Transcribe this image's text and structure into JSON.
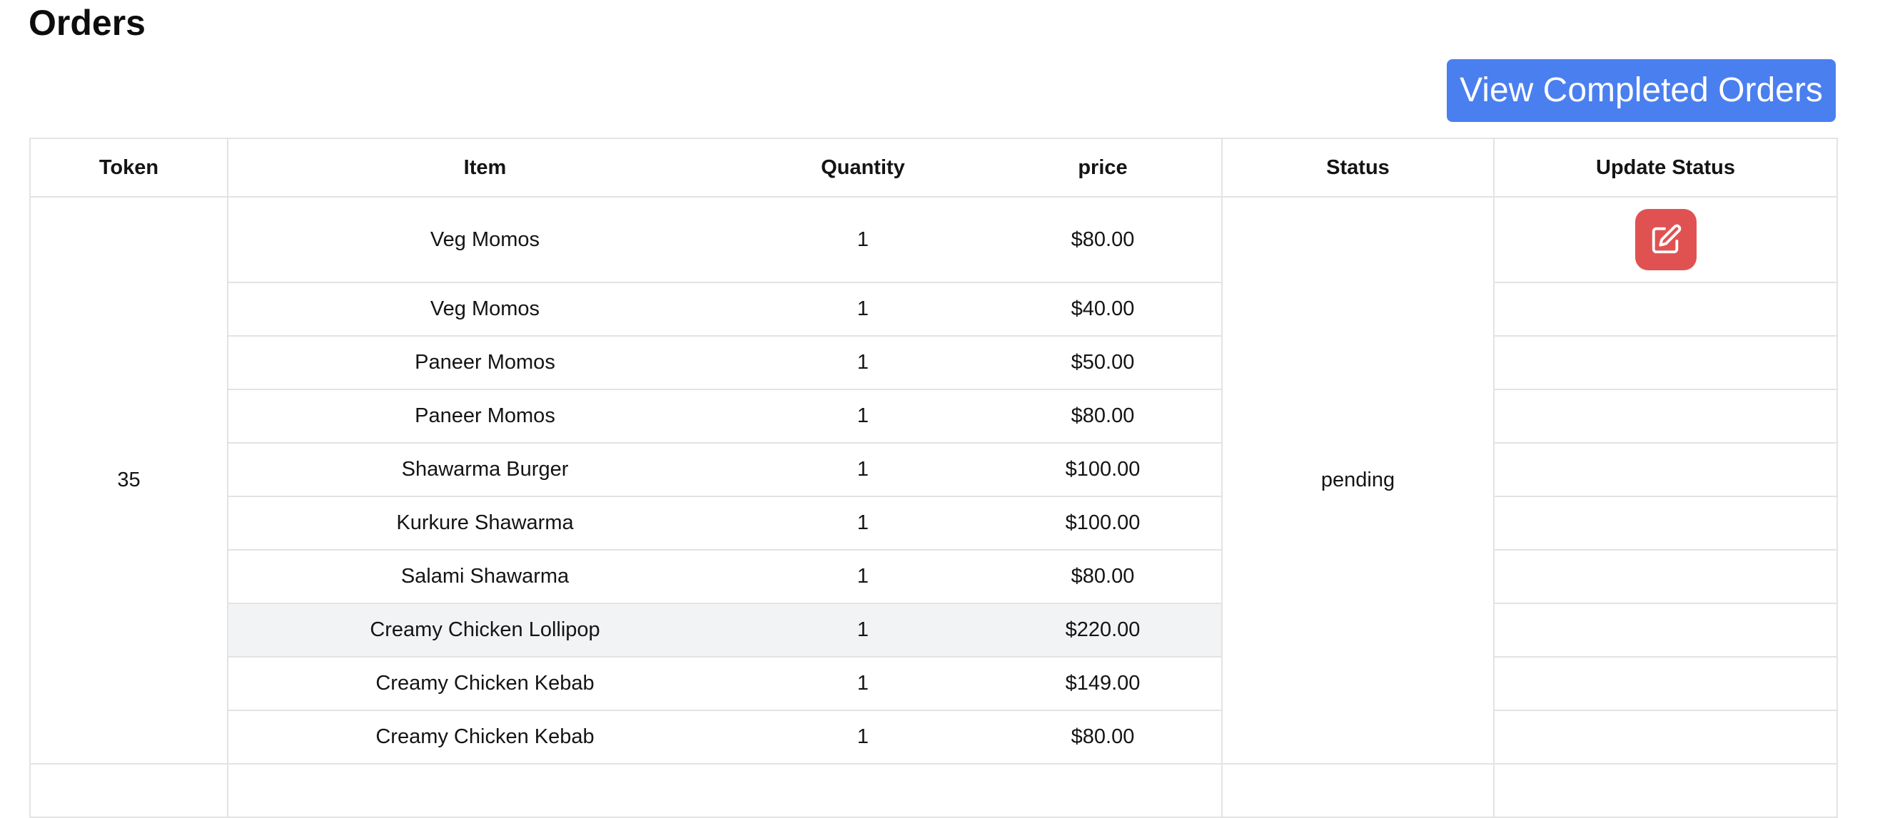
{
  "page": {
    "title": "Orders"
  },
  "toolbar": {
    "view_completed_label": "View Completed Orders"
  },
  "table": {
    "headers": {
      "token": "Token",
      "item": "Item",
      "quantity": "Quantity",
      "price": "price",
      "status": "Status",
      "update_status": "Update Status"
    },
    "order": {
      "token": "35",
      "status": "pending",
      "update_icon": "edit-icon",
      "rows": [
        {
          "item": "Veg Momos",
          "quantity": "1",
          "price": "$80.00"
        },
        {
          "item": "Veg Momos",
          "quantity": "1",
          "price": "$40.00"
        },
        {
          "item": "Paneer Momos",
          "quantity": "1",
          "price": "$50.00"
        },
        {
          "item": "Paneer Momos",
          "quantity": "1",
          "price": "$80.00"
        },
        {
          "item": "Shawarma Burger",
          "quantity": "1",
          "price": "$100.00"
        },
        {
          "item": "Kurkure Shawarma",
          "quantity": "1",
          "price": "$100.00"
        },
        {
          "item": "Salami Shawarma",
          "quantity": "1",
          "price": "$80.00"
        },
        {
          "item": "Creamy Chicken Lollipop",
          "quantity": "1",
          "price": "$220.00"
        },
        {
          "item": "Creamy Chicken Kebab",
          "quantity": "1",
          "price": "$149.00"
        },
        {
          "item": "Creamy Chicken Kebab",
          "quantity": "1",
          "price": "$80.00"
        }
      ]
    }
  },
  "colors": {
    "primary_button": "#4a7ff0",
    "edit_button": "#e05252",
    "row_hover": "#f2f3f5",
    "border": "#e3e3e3"
  }
}
